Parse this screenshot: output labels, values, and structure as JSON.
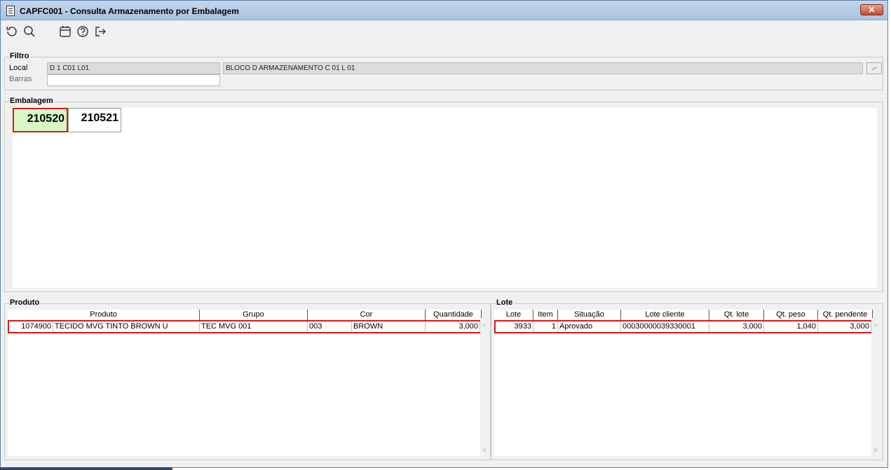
{
  "window": {
    "title": "CAPFC001 - Consulta Armazenamento por Embalagem",
    "close_label": "✕"
  },
  "toolbar": {
    "icons": [
      "refresh-icon",
      "search-icon",
      "calendar-icon",
      "help-icon",
      "exit-icon"
    ]
  },
  "filtro": {
    "legend": "Filtro",
    "local_label": "Local",
    "local_code": "D 1 C01 L01",
    "local_desc": "BLOCO D ARMAZENAMENTO C 01 L 01",
    "barras_label": "Barras",
    "barras_value": ""
  },
  "embalagem": {
    "legend": "Embalagem",
    "tiles": [
      "210520",
      "210521"
    ],
    "selected_index": 0
  },
  "produto": {
    "legend": "Produto",
    "headers": [
      "Produto",
      "Grupo",
      "Cor",
      "Quantidade"
    ],
    "row": {
      "codigo": "1074900",
      "descricao": "TECIDO MVG TINTO BROWN U",
      "grupo": "TEC MVG 001",
      "cor_codigo": "003",
      "cor_nome": "BROWN",
      "quantidade": "3,000"
    }
  },
  "lote": {
    "legend": "Lote",
    "headers": [
      "Lote",
      "Item",
      "Situação",
      "Lote cliente",
      "Qt. lote",
      "Qt. peso",
      "Qt. pendente"
    ],
    "row": {
      "lote": "3933",
      "item": "1",
      "situacao": "Aprovado",
      "lote_cliente": "00030000039330001",
      "qt_lote": "3,000",
      "qt_peso": "1,040",
      "qt_pendente": "3,000"
    }
  },
  "colors": {
    "selection_border": "#d71a1a",
    "selected_tile": "#d7f7c6",
    "titlebar": "#b8cde8"
  }
}
